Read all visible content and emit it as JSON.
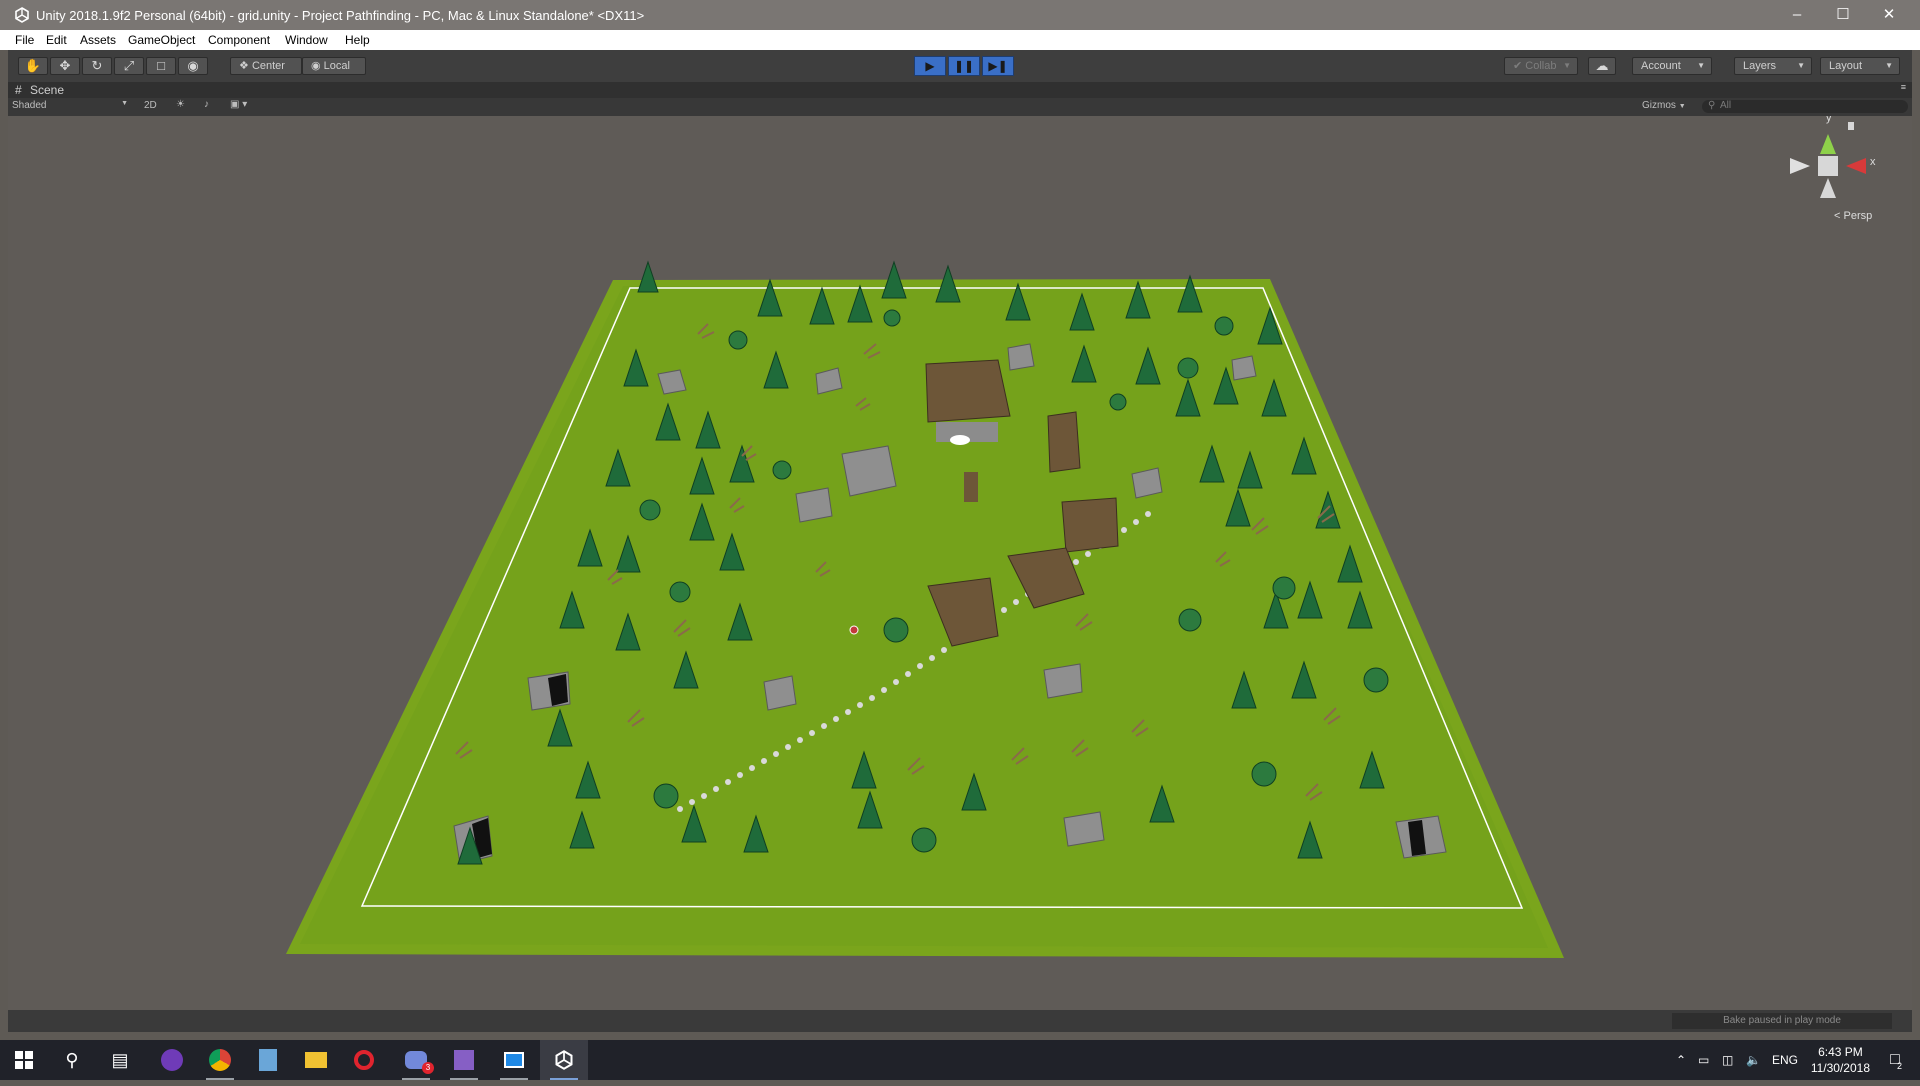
{
  "window": {
    "title": "Unity 2018.1.9f2 Personal (64bit) - grid.unity - Project Pathfinding - PC, Mac & Linux Standalone* <DX11>"
  },
  "menu": [
    "File",
    "Edit",
    "Assets",
    "GameObject",
    "Component",
    "Window",
    "Help"
  ],
  "toolbar": {
    "pivot_label": "Center",
    "space_label": "Local",
    "collab_label": "Collab",
    "account_label": "Account",
    "layers_label": "Layers",
    "layout_label": "Layout"
  },
  "scene": {
    "tab_label": "Scene",
    "shading_mode": "Shaded",
    "mode_2d": "2D",
    "gizmos_label": "Gizmos",
    "search_placeholder": "All",
    "projection_label": "Persp",
    "axis_y": "y",
    "axis_x": "x"
  },
  "status": {
    "bake_message": "Bake paused in play mode"
  },
  "taskbar": {
    "language": "ENG",
    "time": "6:43 PM",
    "date": "11/30/2018",
    "notification_count": "2",
    "discord_badge": "3"
  },
  "colors": {
    "ground": "#7aa51c",
    "ground_inner": "#6f9a18",
    "tree": "#1f6b3a",
    "path": "#d9d9d9",
    "play_accent": "#3a6fc7"
  }
}
